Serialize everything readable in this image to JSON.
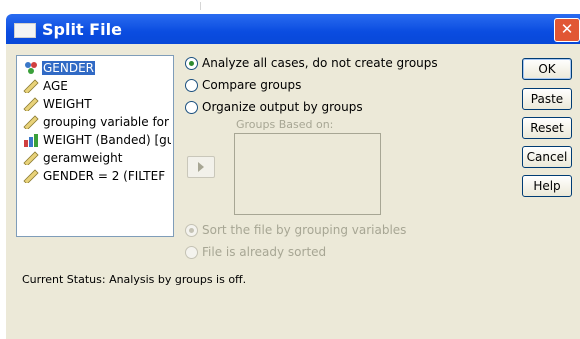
{
  "window": {
    "title": "Split File",
    "close_symbol": "✕"
  },
  "variables": [
    {
      "label": "GENDER",
      "icon": "nominal-variable-icon",
      "selected": true
    },
    {
      "label": "AGE",
      "icon": "scale-variable-icon"
    },
    {
      "label": "WEIGHT",
      "icon": "scale-variable-icon"
    },
    {
      "label": "grouping variable for a",
      "icon": "scale-variable-icon"
    },
    {
      "label": "WEIGHT (Banded) [gu",
      "icon": "ordinal-variable-icon"
    },
    {
      "label": "geramweight",
      "icon": "scale-variable-icon"
    },
    {
      "label": "GENDER = 2 (FILTEF",
      "icon": "scale-variable-icon"
    }
  ],
  "options": {
    "analyze_all": "Analyze all cases, do not create groups",
    "compare_groups": "Compare groups",
    "organize_output": "Organize output by groups",
    "selected": "analyze_all"
  },
  "groups_based_on": "Groups Based on:",
  "sort_options": {
    "sort_file": "Sort the file by grouping variables",
    "already_sorted": "File is already sorted",
    "selected": "sort_file"
  },
  "buttons": {
    "ok": "OK",
    "paste": "Paste",
    "reset": "Reset",
    "cancel": "Cancel",
    "help": "Help"
  },
  "status": "Current Status:  Analysis by groups is off.",
  "colors": {
    "title_bar": "#0a4ce0",
    "dialog_bg": "#ece9d8",
    "selection": "#316ac5",
    "disabled_text": "#a7a694"
  }
}
